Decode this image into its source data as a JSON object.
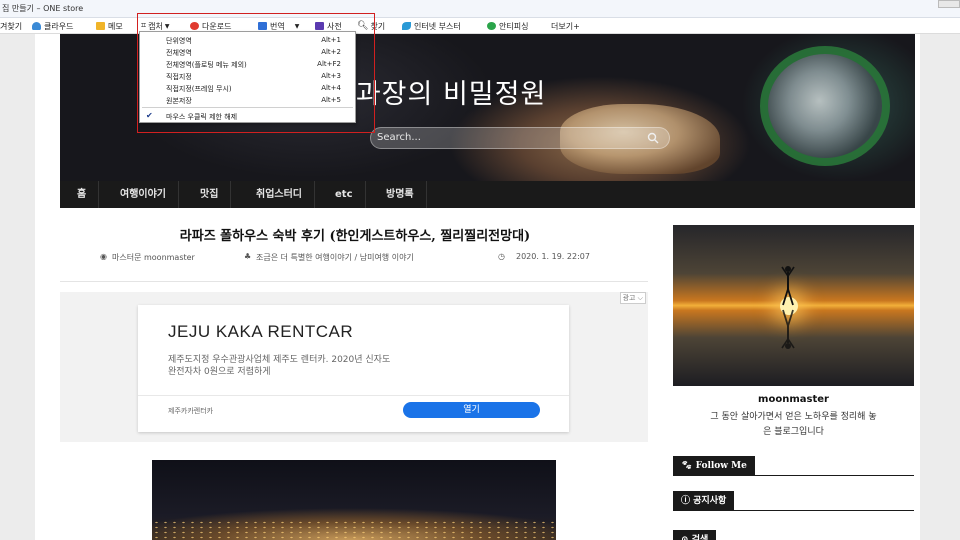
{
  "window": {
    "title": "집 만들기 – ONE store"
  },
  "bookmarks": {
    "items": [
      {
        "label": "겨찾기",
        "icon": "star-icon"
      },
      {
        "label": "클라우드",
        "icon": "cloud-icon"
      },
      {
        "label": "메모",
        "icon": "folder-icon"
      },
      {
        "label": "캡처",
        "icon": "crop-icon"
      },
      {
        "label": "다운로드",
        "icon": "download-icon"
      },
      {
        "label": "번역",
        "icon": "translate-icon"
      },
      {
        "label": "사전",
        "icon": "dictionary-icon"
      },
      {
        "label": "찾기",
        "icon": "search-icon"
      },
      {
        "label": "인터넷 부스터",
        "icon": "rocket-icon"
      },
      {
        "label": "안티피싱",
        "icon": "shield-icon"
      },
      {
        "label": "더보기+",
        "icon": ""
      }
    ]
  },
  "capture_menu": {
    "items": [
      {
        "label": "단위영역",
        "shortcut": "Alt+1"
      },
      {
        "label": "전체영역",
        "shortcut": "Alt+2"
      },
      {
        "label": "전체영역(플로팅 메뉴 제외)",
        "shortcut": "Alt+F2"
      },
      {
        "label": "직접지정",
        "shortcut": "Alt+3"
      },
      {
        "label": "직접지정(프레임 무시)",
        "shortcut": "Alt+4"
      },
      {
        "label": "원본저장",
        "shortcut": "Alt+5"
      }
    ],
    "checked_item": {
      "label": "마우스 우클릭 제한 해제",
      "checked": true
    }
  },
  "blog": {
    "title": "문과장의 비밀정원",
    "search_placeholder": "Search...",
    "nav": [
      "홈",
      "여행이야기",
      "맛집",
      "취업스터디",
      "etc",
      "방명록"
    ]
  },
  "post": {
    "title": "라파즈 폴하우스 숙박 후기 (한인게스트하우스, 찔리찔리전망대)",
    "author": "마스터문 moonmaster",
    "category": "조금은 더 특별한 여행이야기 / 남미여행 이야기",
    "date": "2020. 1. 19. 22:07"
  },
  "ad": {
    "tag": "광고 ⌵",
    "headline": "JEJU KAKA RENTCAR",
    "desc_line1": "제주도지정 우수관광사업체 제주도 렌터카. 2020년 신자도",
    "desc_line2": "완전자차 0원으로 저렴하게",
    "brand": "제주카카렌터카",
    "cta": "열기"
  },
  "sidebar": {
    "name": "moonmaster",
    "desc_line1": "그 동안 살아가면서 얻은 노하우를 정리해 놓",
    "desc_line2": "은 블로그입니다",
    "widgets": [
      {
        "label": "Follow Me",
        "icon": "paw-icon"
      },
      {
        "label": "공지사항",
        "icon": "info-icon"
      },
      {
        "label": "검색",
        "icon": "search-icon"
      }
    ]
  },
  "colors": {
    "nav_bg": "#1a1a1a",
    "cta": "#1a73e8",
    "highlight_frame": "#d12020"
  }
}
